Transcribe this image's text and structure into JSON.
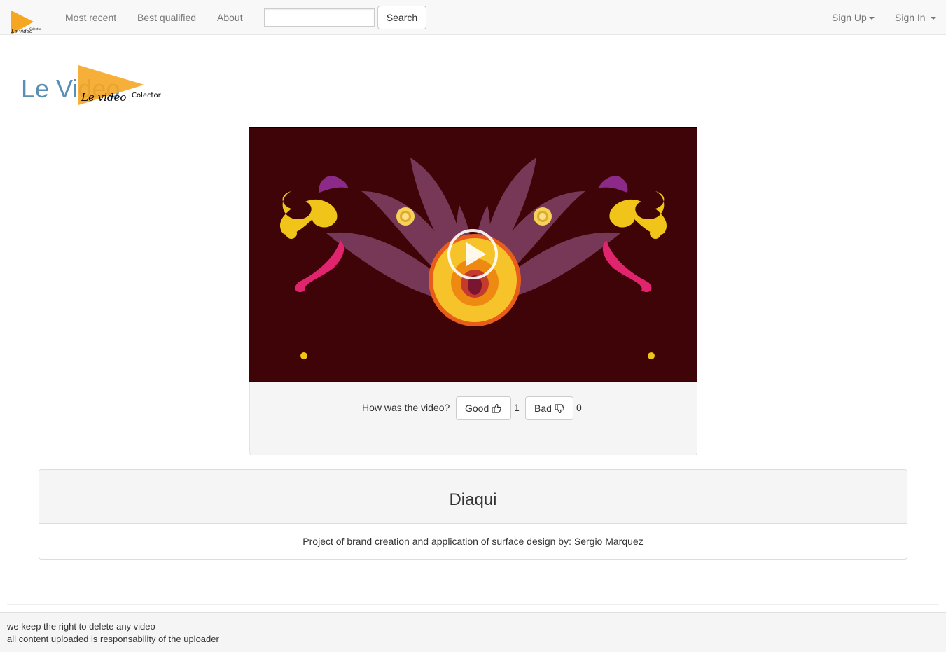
{
  "navbar": {
    "logo_text": "Le video",
    "logo_subtext": "Colector",
    "links": [
      "Most recent",
      "Best qualified",
      "About"
    ],
    "search_placeholder": "",
    "search_label": "Search",
    "sign_up": "Sign Up",
    "sign_in": "Sign In"
  },
  "site": {
    "title": "Le Video",
    "logo_text": "Le video",
    "logo_subtext": "Colector",
    "logo_color": "#f5a623"
  },
  "video": {
    "play_icon": "play-icon",
    "background": "#3f0407"
  },
  "rating": {
    "question": "How was the video?",
    "good_label": "Good",
    "good_icon": "thumbs-up-icon",
    "good_count": "1",
    "bad_label": "Bad",
    "bad_icon": "thumbs-down-icon",
    "bad_count": "0"
  },
  "description": {
    "title": "Diaqui",
    "text": "Project of brand creation and application of surface design by: Sergio Marquez"
  },
  "footer": {
    "line1": "we keep the right to delete any video",
    "line2": "all content uploaded is responsability of the uploader"
  }
}
